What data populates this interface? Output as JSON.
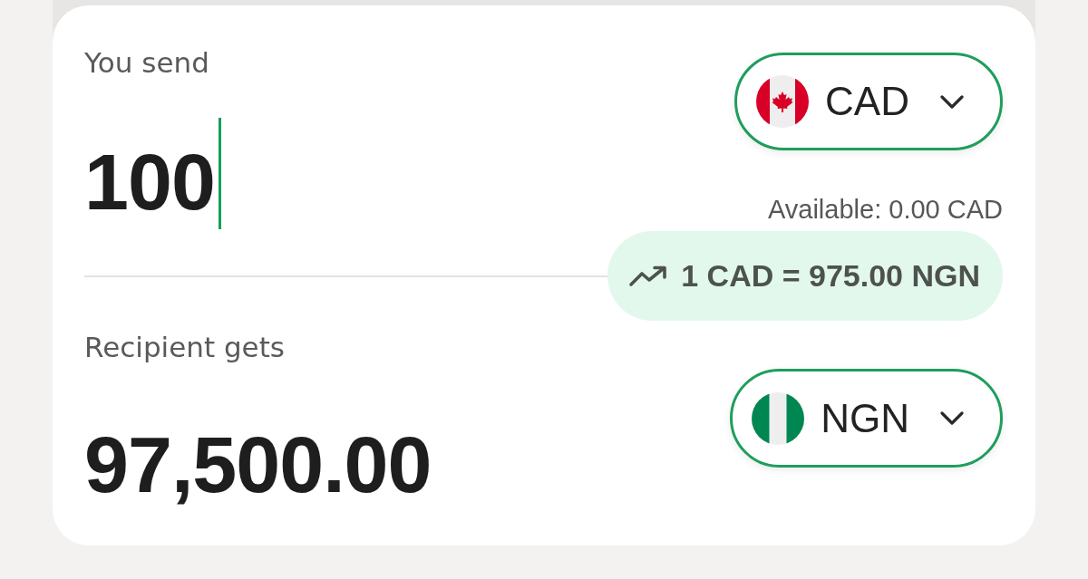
{
  "send": {
    "label": "You send",
    "amount": "100",
    "focused": true,
    "currency": "CAD",
    "available": "Available: 0.00 CAD"
  },
  "rate": {
    "text": "1 CAD = 975.00 NGN"
  },
  "receive": {
    "label": "Recipient gets",
    "amount": "97,500.00",
    "currency": "NGN"
  }
}
